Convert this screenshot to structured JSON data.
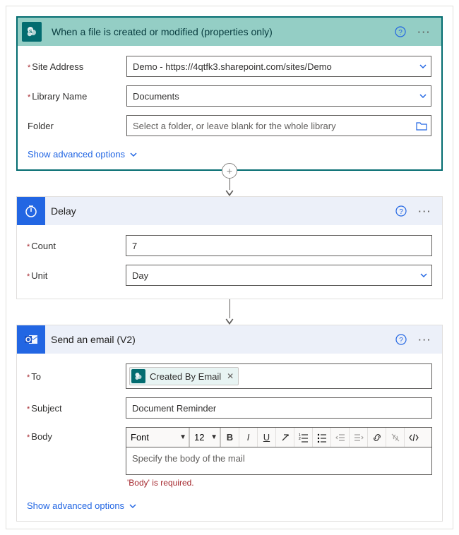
{
  "trigger": {
    "title": "When a file is created or modified (properties only)",
    "fields": {
      "siteAddress": {
        "label": "Site Address",
        "value": "Demo - https://4qtfk3.sharepoint.com/sites/Demo"
      },
      "libraryName": {
        "label": "Library Name",
        "value": "Documents"
      },
      "folder": {
        "label": "Folder",
        "placeholder": "Select a folder, or leave blank for the whole library"
      }
    },
    "advanced": "Show advanced options"
  },
  "delay": {
    "title": "Delay",
    "fields": {
      "count": {
        "label": "Count",
        "value": "7"
      },
      "unit": {
        "label": "Unit",
        "value": "Day"
      }
    }
  },
  "email": {
    "title": "Send an email (V2)",
    "fields": {
      "to": {
        "label": "To",
        "token": "Created By Email"
      },
      "subject": {
        "label": "Subject",
        "value": "Document Reminder"
      },
      "body": {
        "label": "Body",
        "placeholder": "Specify the body of the mail",
        "error": "'Body' is required."
      }
    },
    "rte": {
      "font": "Font",
      "size": "12"
    },
    "advanced": "Show advanced options"
  }
}
